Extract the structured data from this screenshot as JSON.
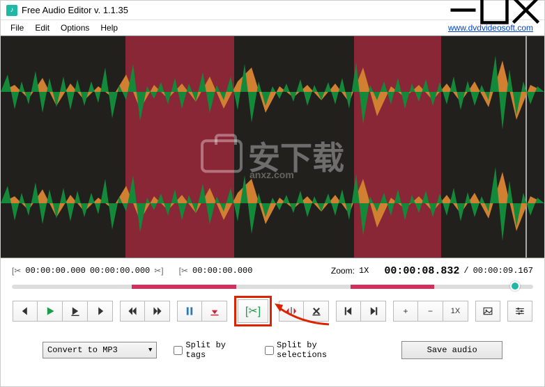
{
  "titlebar": {
    "title": "Free Audio Editor v. 1.1.35"
  },
  "menu": {
    "file": "File",
    "edit": "Edit",
    "options": "Options",
    "help": "Help",
    "link": "www.dvdvideosoft.com"
  },
  "info": {
    "sel_start": "00:00:00.000",
    "sel_end": "00:00:00.000",
    "cursor": "00:00:00.000",
    "zoom_label": "Zoom:",
    "zoom_value": "1X",
    "current_time": "00:00:08.832",
    "sep": "/",
    "total_time": "00:00:09.167"
  },
  "toolbar": {
    "zoom_btn": "1X"
  },
  "bottom": {
    "convert": "Convert to MP3",
    "split_tags": "Split by tags",
    "split_sel": "Split by selections",
    "save": "Save audio"
  },
  "watermark": {
    "text": "安下载",
    "url": "anxz.com"
  }
}
